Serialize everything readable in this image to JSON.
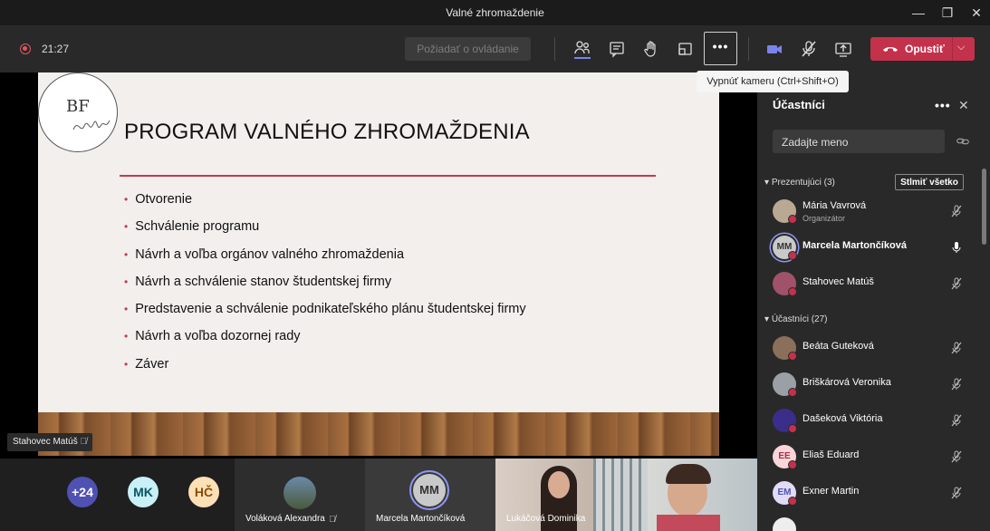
{
  "window": {
    "title": "Valné zhromaždenie"
  },
  "toolbar": {
    "timer": "21:27",
    "request_control_label": "Požiadať o ovládanie",
    "more_label": "•••",
    "leave_label": "Opustiť",
    "tooltip": "Vypnúť kameru (Ctrl+Shift+O)"
  },
  "slide": {
    "logo_text": "BF",
    "title": "PROGRAM VALNÉHO ZHROMAŽDENIA",
    "items": [
      "Otvorenie",
      "Schválenie programu",
      "Návrh a voľba orgánov valného zhromaždenia",
      "Návrh a schválenie stanov študentskej firmy",
      "Predstavenie a schválenie podnikateľského plánu študentskej firmy",
      "Návrh a voľba dozornej rady",
      "Záver"
    ]
  },
  "presenter_label": "Stahovec Matúš",
  "strip": {
    "overflow_count": "+24",
    "initials": [
      "MK",
      "HČ"
    ],
    "tiles": [
      {
        "name": "Voláková Alexandra"
      },
      {
        "name": "Marcela Martončíková",
        "initials": "MM"
      },
      {
        "name": "Lukáčová Dominika"
      }
    ]
  },
  "participants_panel": {
    "title": "Účastníci",
    "search_placeholder": "Zadajte meno",
    "presenters_header": "Prezentujúci (3)",
    "mute_all_label": "Stlmiť všetko",
    "presenters": [
      {
        "name": "Mária Vavrová",
        "role": "Organizátor",
        "mic": "muted"
      },
      {
        "name": "Marcela Martončíková",
        "initials": "MM",
        "mic": "on"
      },
      {
        "name": "Stahovec Matúš",
        "mic": "muted"
      }
    ],
    "attendees_header": "Účastníci (27)",
    "attendees": [
      {
        "name": "Beáta Guteková",
        "mic": "muted"
      },
      {
        "name": "Briškárová Veronika",
        "mic": "muted"
      },
      {
        "name": "Dašeková Viktória",
        "mic": "muted"
      },
      {
        "name": "Eliaš Eduard",
        "initials": "EE",
        "mic": "muted"
      },
      {
        "name": "Exner Martin",
        "initials": "EM",
        "mic": "muted"
      }
    ]
  },
  "colors": {
    "leave": "#c4314b",
    "accent": "#6264a7",
    "slide_rule": "#c23b4a"
  }
}
